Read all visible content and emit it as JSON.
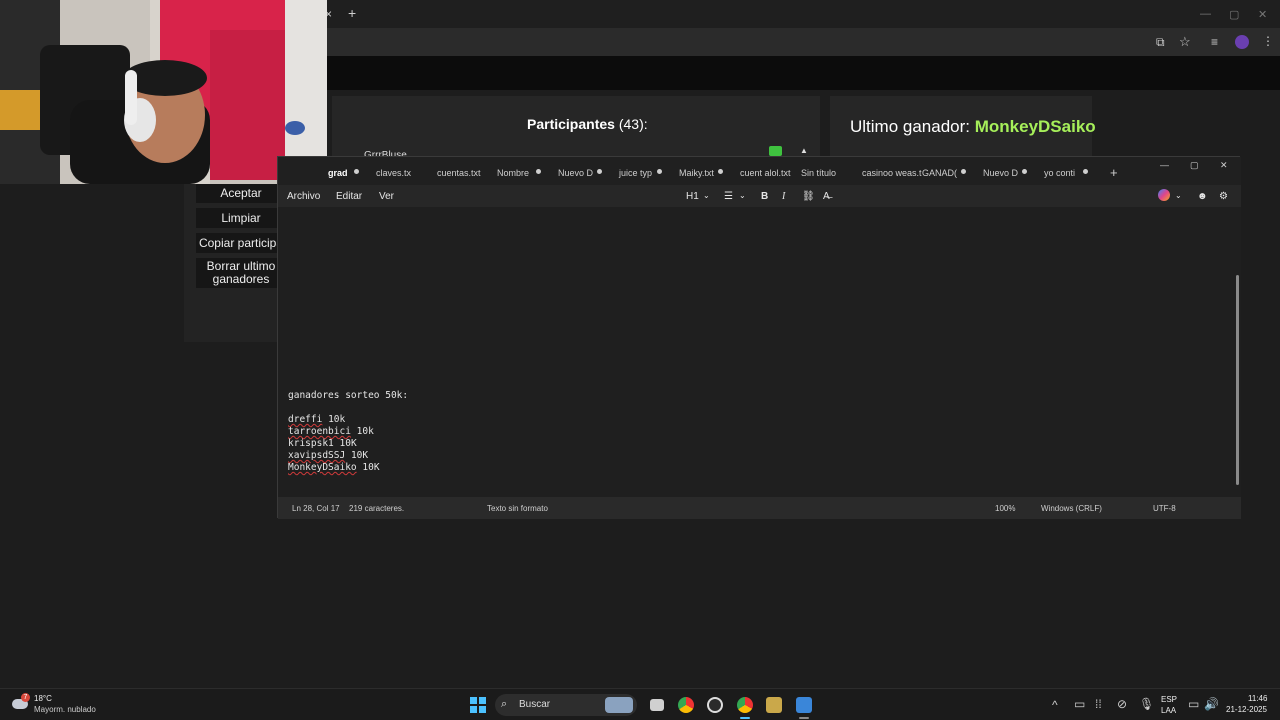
{
  "browser": {
    "new_tab_glyph": "+",
    "close_tab_glyph": "×"
  },
  "sidebar": {
    "buttons": [
      "Aceptar",
      "Limpiar",
      "Copiar participa",
      "Borrar ultimo",
      "ganadores"
    ]
  },
  "participants": {
    "title": "Participantes",
    "count": "(43):",
    "first_visible": "GrrrBluse"
  },
  "winner": {
    "label": "Ultimo ganador: ",
    "name": "MonkeyDSaiko"
  },
  "notepad": {
    "tabs": [
      "grad",
      "claves.tx",
      "cuentas.txt",
      "Nombre",
      "Nuevo D",
      "juice typ",
      "Maiky.txt",
      "cuent alol.txt",
      "Sin título",
      "casinoo weas.t",
      "GANAD(",
      "Nuevo D",
      "yo conti"
    ],
    "add_tab": "+",
    "menu": {
      "file": "Archivo",
      "edit": "Editar",
      "view": "Ver"
    },
    "toolbar": {
      "heading": "H1",
      "bold": "B",
      "italic": "I"
    },
    "content": {
      "heading": "ganadores sorteo 50k:",
      "lines": [
        {
          "name": "dreffi",
          "amount": "10k"
        },
        {
          "name": "tarroenbici",
          "amount": "10k"
        },
        {
          "name": "krispsk1",
          "amount": "10K"
        },
        {
          "name": "xavipsdSSJ",
          "amount": "10K"
        },
        {
          "name": "MonkeyDSaiko",
          "amount": "10K"
        }
      ]
    },
    "status": {
      "position": "Ln 28, Col 17",
      "chars": "219 caracteres.",
      "format": "Texto sin formato",
      "zoom": "100%",
      "line_endings": "Windows (CRLF)",
      "encoding": "UTF-8"
    }
  },
  "taskbar": {
    "weather_temp": "18°C",
    "weather_desc": "Mayorm. nublado",
    "search_placeholder": "Buscar",
    "lang_top": "ESP",
    "lang_bottom": "LAA",
    "time": "11:46",
    "date": "21-12-2025",
    "weather_badge": "7"
  }
}
